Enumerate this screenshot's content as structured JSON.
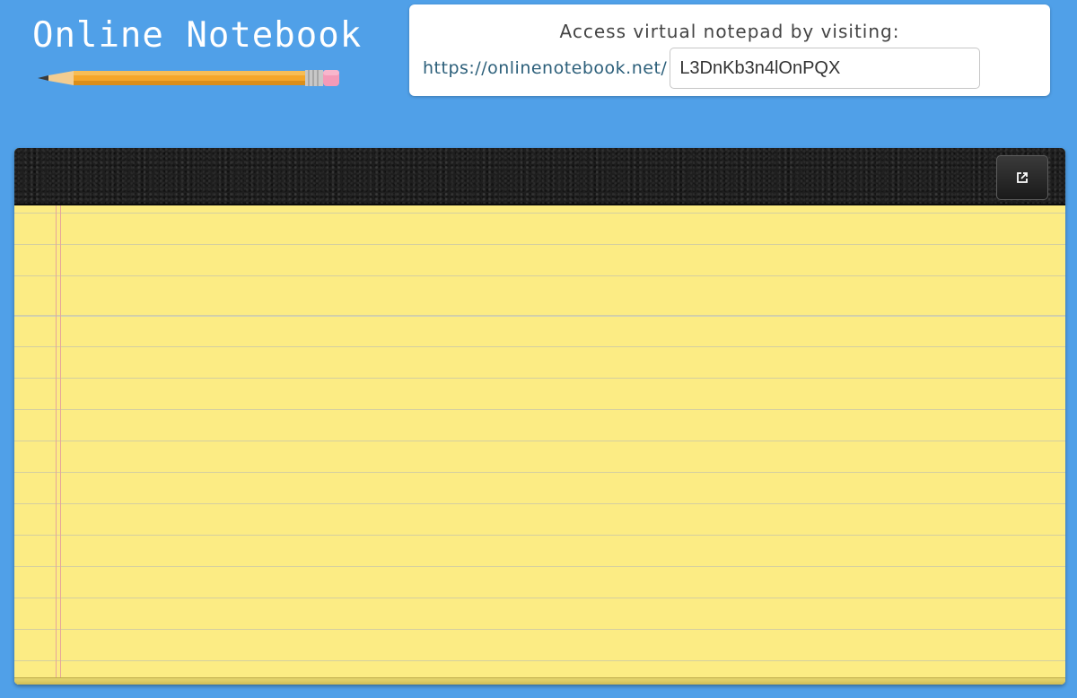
{
  "logo": {
    "title": "Online Notebook",
    "pencil_icon": "pencil-icon"
  },
  "access": {
    "label": "Access virtual notepad by visiting:",
    "base_url": "https://onlinenotebook.net/",
    "code": "L3DnKb3n4lOnPQX"
  },
  "notepad": {
    "fullscreen_icon": "external-expand-icon",
    "content": ""
  },
  "colors": {
    "background": "#50a0e8",
    "paper": "#fcec84",
    "leather": "#1e1e1e",
    "margin_line": "#e6a69a",
    "url_text": "#2c5f7a"
  }
}
